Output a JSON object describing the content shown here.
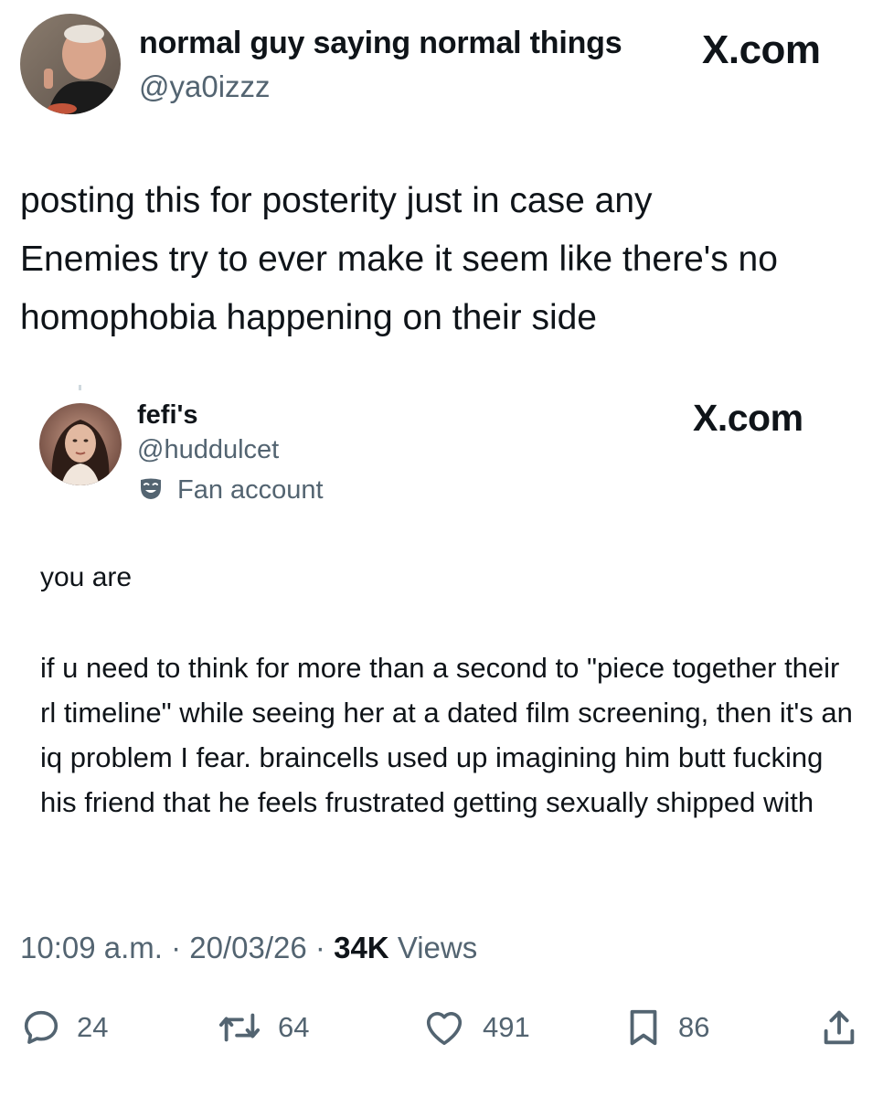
{
  "author": {
    "name": "normal guy saying normal things",
    "handle": "@ya0izzz",
    "site": "X.com"
  },
  "tweet": {
    "text": "posting this for posterity just in case any\nEnemies try to ever make it seem like there's no\nhomophobia happening on their side"
  },
  "quoted": {
    "name": "fefi's",
    "handle": "@huddulcet",
    "badge_label": "Fan account",
    "badge_icon": "theater-mask-icon",
    "site": "X.com",
    "line1": "you are",
    "paragraph": "if u need to think for more than a second to \"piece together their rl timeline\" while seeing her at a dated film screening, then it's an iq problem I fear. braincells used up imagining him butt fucking his friend that he feels frustrated getting sexually shipped with"
  },
  "meta": {
    "time": "10:09 a.m.",
    "date": "20/03/26",
    "views_count": "34K",
    "views_label": "Views",
    "separator": "·"
  },
  "actions": {
    "replies": "24",
    "reposts": "64",
    "likes": "491",
    "bookmarks": "86"
  },
  "colors": {
    "text": "#0f1419",
    "secondary": "#536471"
  }
}
